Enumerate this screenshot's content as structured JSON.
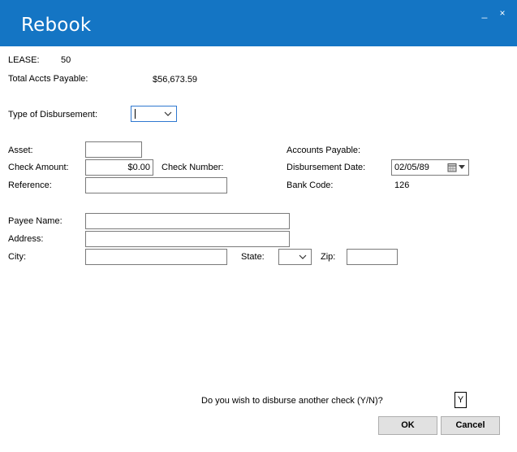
{
  "window": {
    "title": "Rebook",
    "minimize_glyph": "_",
    "close_glyph": "×"
  },
  "lease": {
    "label": "LEASE:",
    "value": "50"
  },
  "total_ap": {
    "label": "Total Accts Payable:",
    "value": "$56,673.59"
  },
  "disbursement_type": {
    "label": "Type of Disbursement:",
    "value": ""
  },
  "asset": {
    "label": "Asset:",
    "value": ""
  },
  "check_amount": {
    "label": "Check Amount:",
    "value": "$0.00"
  },
  "check_number": {
    "label": "Check Number:"
  },
  "reference": {
    "label": "Reference:",
    "value": ""
  },
  "accounts_payable": {
    "label": "Accounts Payable:",
    "value": ""
  },
  "disbursement_date": {
    "label": "Disbursement Date:",
    "value": "02/05/89"
  },
  "bank_code": {
    "label": "Bank Code:",
    "value": "126"
  },
  "payee_name": {
    "label": "Payee Name:",
    "value": ""
  },
  "address": {
    "label": "Address:",
    "value": ""
  },
  "city": {
    "label": "City:",
    "value": ""
  },
  "state": {
    "label": "State:",
    "value": ""
  },
  "zip": {
    "label": "Zip:",
    "value": ""
  },
  "prompt": {
    "text": "Do you wish to disburse another check (Y/N)?",
    "answer": "Y"
  },
  "buttons": {
    "ok": "OK",
    "cancel": "Cancel"
  },
  "colors": {
    "titlebar": "#1475c4",
    "focus_border": "#2f78d0",
    "button_face": "#e1e1e1"
  },
  "icons": {
    "dropdown": "chevron-down-icon",
    "calendar": "calendar-icon",
    "date_drop": "triangle-down-icon"
  }
}
